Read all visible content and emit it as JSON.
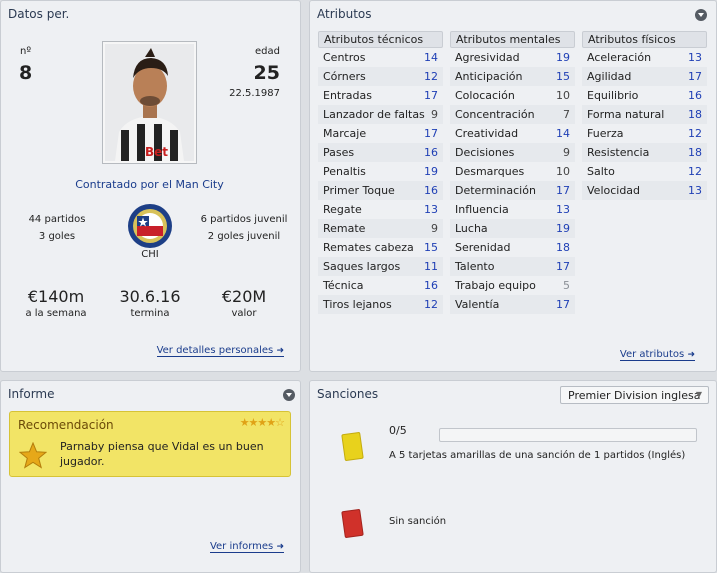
{
  "datos": {
    "title": "Datos per.",
    "number_label": "nº",
    "number": "8",
    "age_label": "edad",
    "age": "25",
    "birth_date": "22.5.1987",
    "contract_text": "Contratado por el Man City",
    "matches": "44 partidos",
    "goals": "3 goles",
    "youth_matches": "6 partidos juvenil",
    "youth_goals": "2 goles juvenil",
    "nation": "CHI",
    "wage": "€140m",
    "wage_label": "a la semana",
    "contract_end": "30.6.16",
    "contract_end_label": "termina",
    "value": "€20M",
    "value_label": "valor",
    "link": "Ver detalles personales"
  },
  "atributos": {
    "title": "Atributos",
    "link": "Ver atributos",
    "columns": [
      {
        "header": "Atributos técnicos",
        "rows": [
          {
            "name": "Centros",
            "value": "14"
          },
          {
            "name": "Córners",
            "value": "12"
          },
          {
            "name": "Entradas",
            "value": "17"
          },
          {
            "name": "Lanzador de faltas",
            "value": "9"
          },
          {
            "name": "Marcaje",
            "value": "17"
          },
          {
            "name": "Pases",
            "value": "16"
          },
          {
            "name": "Penaltis",
            "value": "19"
          },
          {
            "name": "Primer Toque",
            "value": "16"
          },
          {
            "name": "Regate",
            "value": "13"
          },
          {
            "name": "Remate",
            "value": "9"
          },
          {
            "name": "Remates cabeza",
            "value": "15"
          },
          {
            "name": "Saques largos",
            "value": "11"
          },
          {
            "name": "Técnica",
            "value": "16"
          },
          {
            "name": "Tiros lejanos",
            "value": "12"
          }
        ]
      },
      {
        "header": "Atributos mentales",
        "rows": [
          {
            "name": "Agresividad",
            "value": "19"
          },
          {
            "name": "Anticipación",
            "value": "15"
          },
          {
            "name": "Colocación",
            "value": "10"
          },
          {
            "name": "Concentración",
            "value": "7"
          },
          {
            "name": "Creatividad",
            "value": "14"
          },
          {
            "name": "Decisiones",
            "value": "9"
          },
          {
            "name": "Desmarques",
            "value": "10"
          },
          {
            "name": "Determinación",
            "value": "17"
          },
          {
            "name": "Influencia",
            "value": "13"
          },
          {
            "name": "Lucha",
            "value": "19"
          },
          {
            "name": "Serenidad",
            "value": "18"
          },
          {
            "name": "Talento",
            "value": "17"
          },
          {
            "name": "Trabajo equipo",
            "value": "5"
          },
          {
            "name": "Valentía",
            "value": "17"
          }
        ]
      },
      {
        "header": "Atributos físicos",
        "rows": [
          {
            "name": "Aceleración",
            "value": "13"
          },
          {
            "name": "Agilidad",
            "value": "17"
          },
          {
            "name": "Equilibrio",
            "value": "16"
          },
          {
            "name": "Forma natural",
            "value": "18"
          },
          {
            "name": "Fuerza",
            "value": "12"
          },
          {
            "name": "Resistencia",
            "value": "18"
          },
          {
            "name": "Salto",
            "value": "12"
          },
          {
            "name": "Velocidad",
            "value": "13"
          }
        ]
      }
    ]
  },
  "informe": {
    "title": "Informe",
    "rec_title": "Recomendación",
    "rating_stars": 4,
    "rec_text_line1": "Parnaby piensa que Vidal es un buen",
    "rec_text_line2": "jugador.",
    "link": "Ver informes"
  },
  "sanciones": {
    "title": "Sanciones",
    "competition": "Premier Division inglesa",
    "yellow_count": "0/5",
    "yellow_progress": 0,
    "yellow_text": "A 5 tarjetas amarillas de una sanción de 1 partidos (Inglés)",
    "red_text": "Sin sanción",
    "colors": {
      "yellow_card": "#e8d21c",
      "red_card": "#d0312a"
    }
  }
}
